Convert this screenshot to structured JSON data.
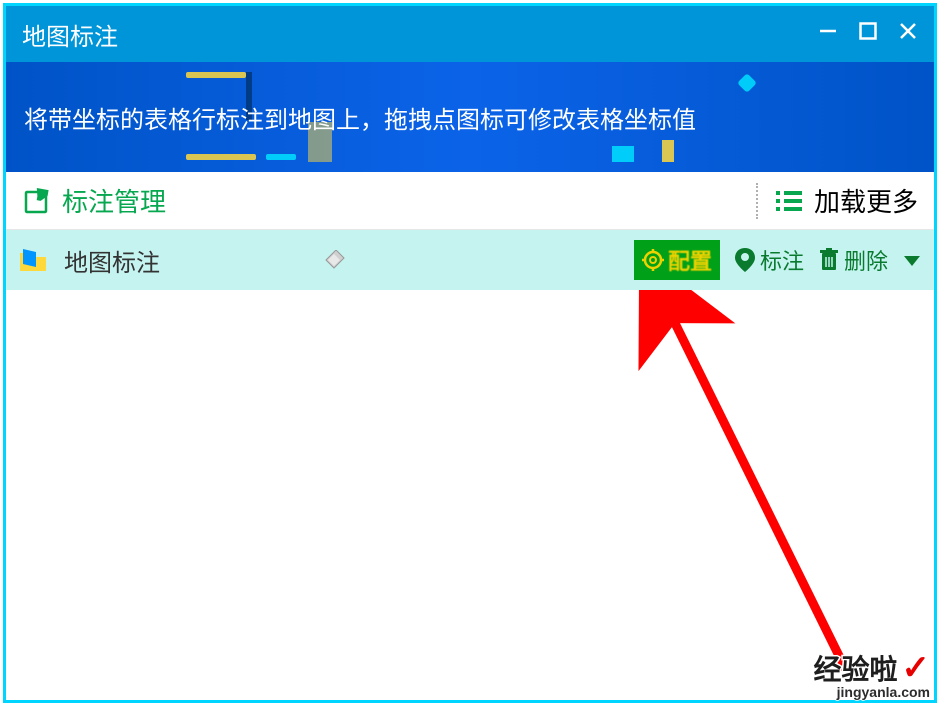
{
  "window": {
    "title": "地图标注"
  },
  "banner": {
    "text": "将带坐标的表格行标注到地图上，拖拽点图标可修改表格坐标值"
  },
  "section": {
    "left_label": "标注管理",
    "right_label": "加载更多"
  },
  "item": {
    "name": "地图标注",
    "actions": {
      "config": "配置",
      "mark": "标注",
      "delete": "删除"
    }
  },
  "watermark": {
    "brand": "经验啦",
    "url": "jingyanla.com"
  }
}
